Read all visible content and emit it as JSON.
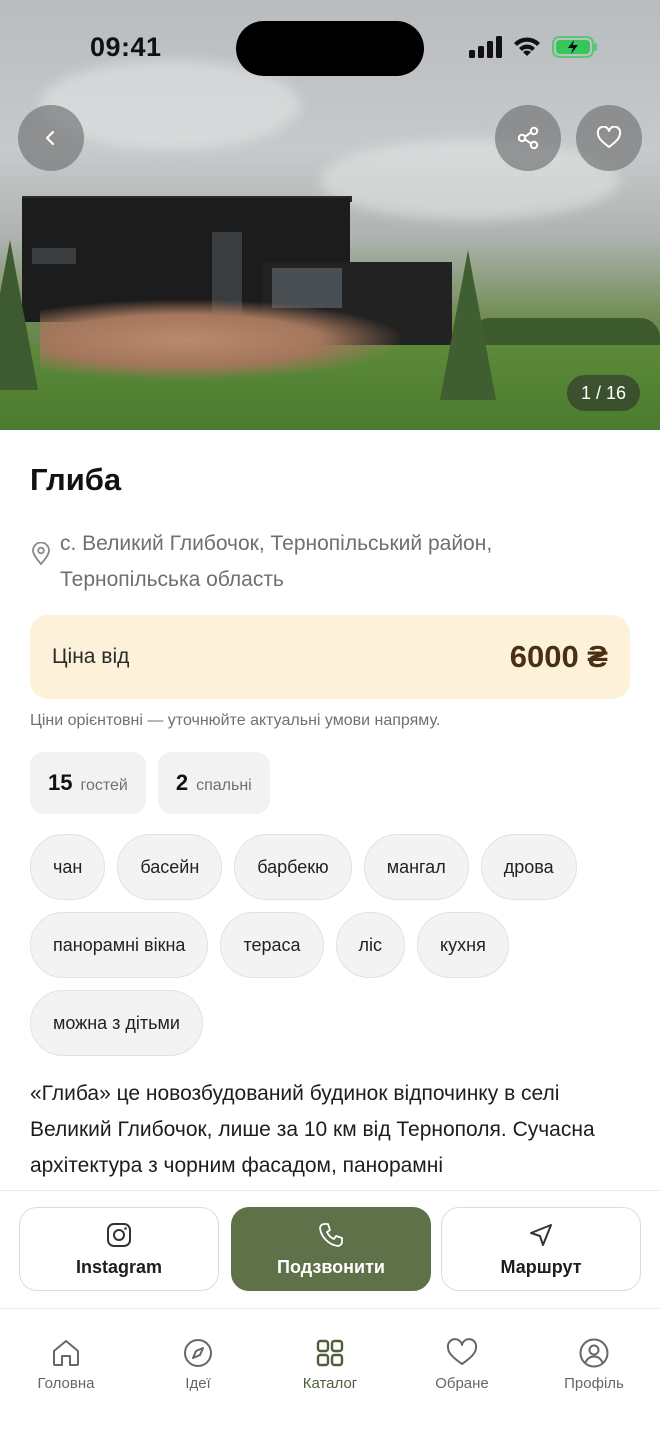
{
  "status_bar": {
    "time": "09:41"
  },
  "hero": {
    "counter": "1 / 16"
  },
  "listing": {
    "title": "Глиба",
    "address": "с. Великий Глибочок, Тернопільський район, Тернопільська область",
    "price_label": "Ціна від",
    "price_value": "6000 ₴",
    "price_note": "Ціни орієнтовні — уточнюйте актуальні умови напряму.",
    "stats": [
      {
        "num": "15",
        "label": "гостей"
      },
      {
        "num": "2",
        "label": "спальні"
      }
    ],
    "tags": [
      "чан",
      "басейн",
      "барбекю",
      "мангал",
      "дрова",
      "панорамні вікна",
      "тераса",
      "ліс",
      "кухня",
      "можна з дітьми"
    ],
    "description": "«Глиба» це новозбудований будинок відпочинку в селі Великий Глибочок, лише за 10 км від Тернополя. Сучасна архітектура з чорним фасадом, панорамні"
  },
  "actions": {
    "instagram": "Instagram",
    "call": "Подзвонити",
    "route": "Маршрут"
  },
  "tabs": [
    {
      "label": "Головна",
      "icon": "home-icon"
    },
    {
      "label": "Ідеї",
      "icon": "compass-icon"
    },
    {
      "label": "Каталог",
      "icon": "grid-icon"
    },
    {
      "label": "Обране",
      "icon": "heart-icon"
    },
    {
      "label": "Профіль",
      "icon": "profile-icon"
    }
  ],
  "colors": {
    "accent": "#5f7149",
    "price_bg": "#fdf2d9",
    "price_text": "#4a2f14",
    "battery": "#34c759"
  }
}
